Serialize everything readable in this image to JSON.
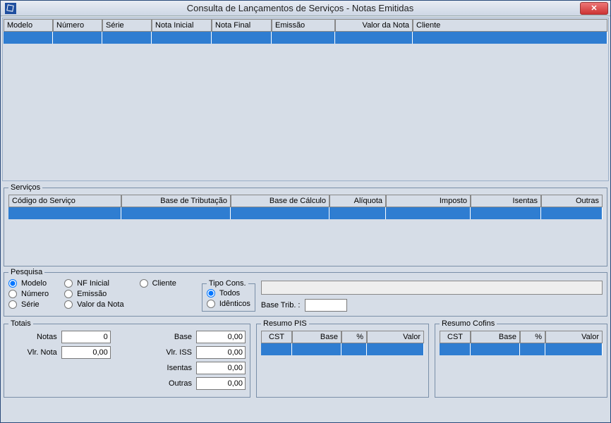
{
  "window": {
    "title": "Consulta de Lançamentos de Serviços - Notas Emitidas"
  },
  "main_grid": {
    "headers": [
      "Modelo",
      "Número",
      "Série",
      "Nota Inicial",
      "Nota Final",
      "Emissão",
      "Valor da Nota",
      "Cliente"
    ]
  },
  "servicos": {
    "legend": "Serviços",
    "headers": [
      "Código do Serviço",
      "Base de Tributação",
      "Base de Cálculo",
      "Alíquota",
      "Imposto",
      "Isentas",
      "Outras"
    ]
  },
  "pesquisa": {
    "legend": "Pesquisa",
    "col1": [
      "Modelo",
      "Número",
      "Série"
    ],
    "col2": [
      "NF Inicial",
      "Emissão",
      "Valor da Nota"
    ],
    "col3": [
      "Cliente"
    ],
    "tipo": {
      "legend": "Tipo Cons.",
      "options": [
        "Todos",
        "Idênticos"
      ]
    },
    "base_trib_label": "Base Trib. :",
    "base_trib_value": ""
  },
  "totais": {
    "legend": "Totais",
    "labels": {
      "notas": "Notas",
      "vlr_nota": "Vlr. Nota",
      "base": "Base",
      "vlr_iss": "Vlr. ISS",
      "isentas": "Isentas",
      "outras": "Outras"
    },
    "values": {
      "notas": "0",
      "vlr_nota": "0,00",
      "base": "0,00",
      "vlr_iss": "0,00",
      "isentas": "0,00",
      "outras": "0,00"
    }
  },
  "resumo_pis": {
    "legend": "Resumo PIS",
    "headers": [
      "CST",
      "Base",
      "%",
      "Valor"
    ]
  },
  "resumo_cofins": {
    "legend": "Resumo Cofins",
    "headers": [
      "CST",
      "Base",
      "%",
      "Valor"
    ]
  }
}
